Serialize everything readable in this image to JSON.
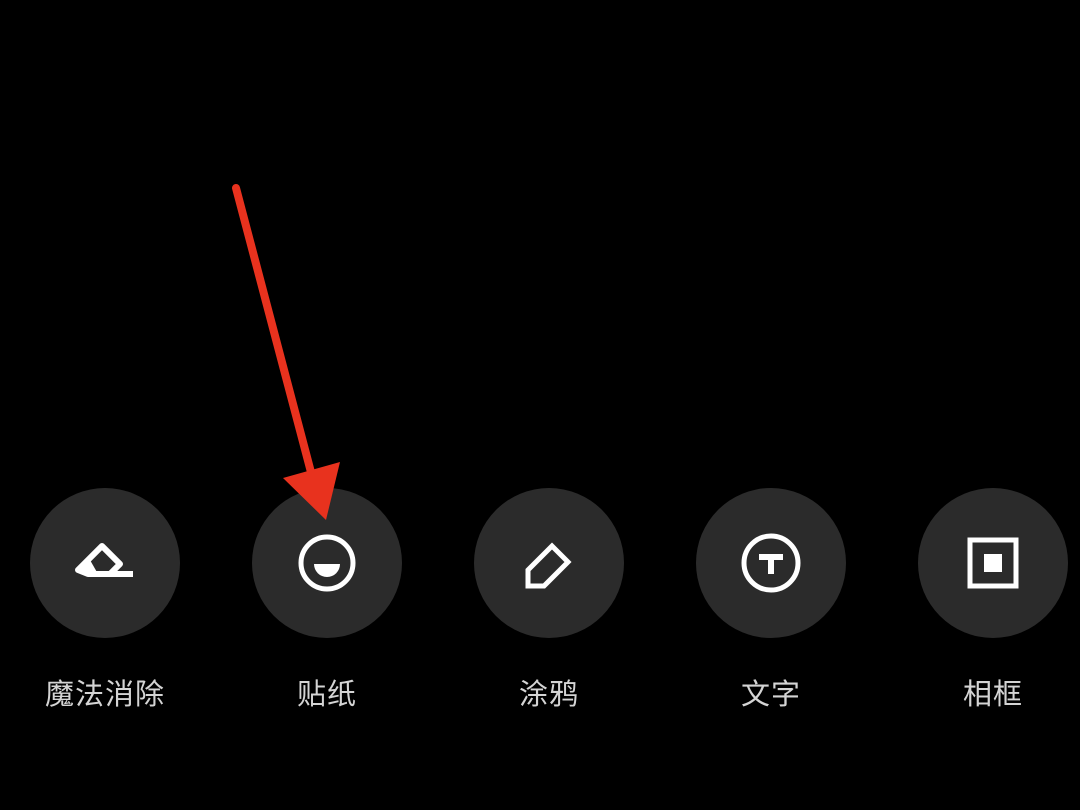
{
  "toolbar": {
    "tools": [
      {
        "label": "魔法消除",
        "icon": "eraser-icon"
      },
      {
        "label": "贴纸",
        "icon": "sticker-face-icon"
      },
      {
        "label": "涂鸦",
        "icon": "pencil-icon"
      },
      {
        "label": "文字",
        "icon": "text-t-icon"
      },
      {
        "label": "相框",
        "icon": "frame-icon"
      }
    ]
  },
  "annotation": {
    "arrow_color": "#e8321e"
  },
  "colors": {
    "background": "#000000",
    "button_fill": "#2b2b2b",
    "icon": "#ffffff",
    "label": "#d4d4d4"
  }
}
